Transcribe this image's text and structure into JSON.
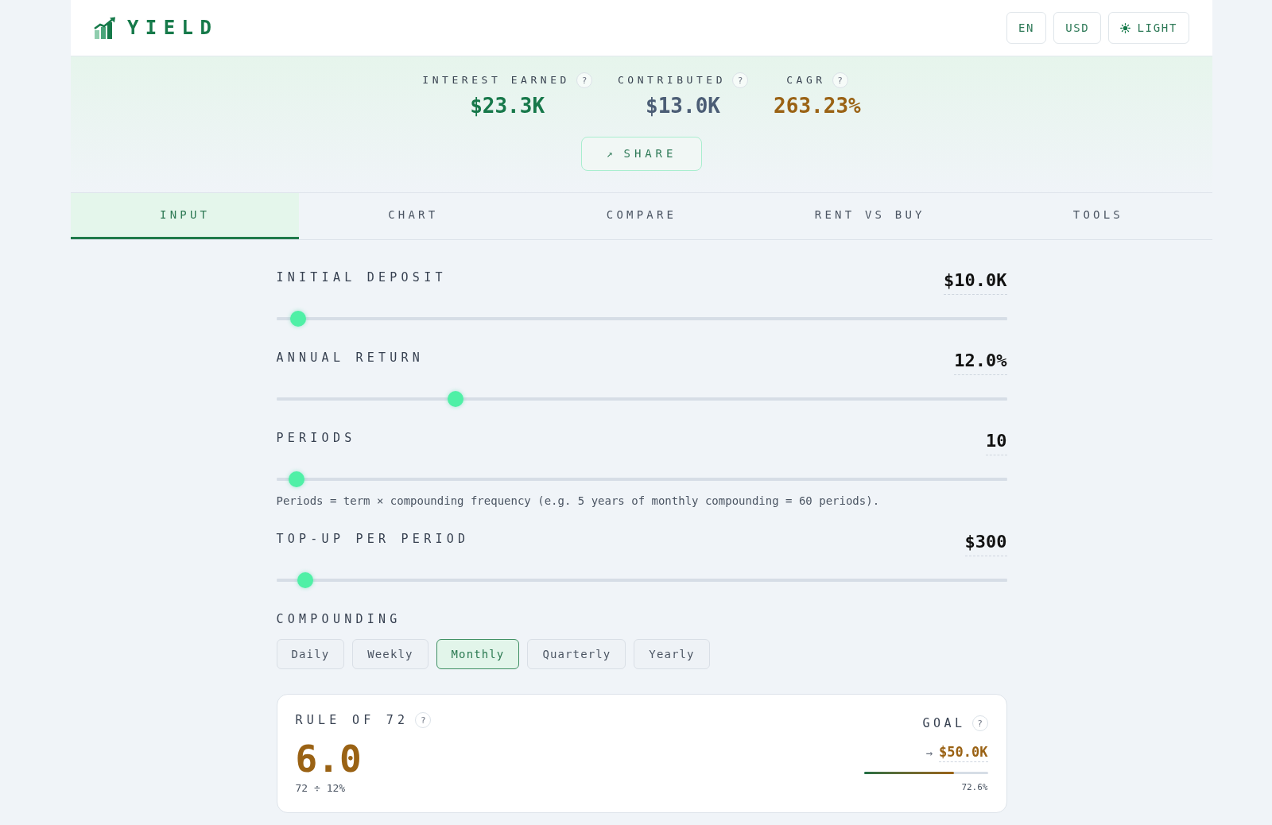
{
  "header": {
    "logo": "YIELD",
    "controls": [
      {
        "kind": "plain",
        "label": "EN"
      },
      {
        "kind": "plain",
        "label": "USD"
      },
      {
        "kind": "theme",
        "label": "LIGHT"
      }
    ]
  },
  "stats": [
    {
      "label": "INTEREST EARNED",
      "help": "?",
      "value": "$23.3K",
      "color": "#17784a"
    },
    {
      "label": "CONTRIBUTED",
      "help": "?",
      "value": "$13.0K",
      "color": "#4b5d75"
    },
    {
      "label": "CAGR",
      "help": "?",
      "value": "263.23%",
      "color": "#9a6214"
    }
  ],
  "share_button": {
    "icon": "↗",
    "label": "SHARE"
  },
  "tabs": [
    {
      "label": "INPUT",
      "selected": true
    },
    {
      "label": "CHART",
      "selected": false
    },
    {
      "label": "COMPARE",
      "selected": false
    },
    {
      "label": "RENT VS BUY",
      "selected": false
    },
    {
      "label": "TOOLS",
      "selected": false
    }
  ],
  "sliders": [
    {
      "label": "INITIAL DEPOSIT",
      "value": "$10.0K",
      "level": 0.02
    },
    {
      "label": "ANNUAL RETURN",
      "value": "12.0%",
      "level": 0.24
    },
    {
      "label": "PERIODS",
      "value": "10",
      "level": 0.017,
      "note": "Periods = term × compounding frequency (e.g. 5 years of monthly compounding = 60 periods)."
    },
    {
      "label": "TOP-UP PER PERIOD",
      "value": "$300",
      "level": 0.03
    }
  ],
  "compounding": {
    "label": "COMPOUNDING",
    "options": [
      {
        "label": "Daily",
        "selected": false
      },
      {
        "label": "Weekly",
        "selected": false
      },
      {
        "label": "Monthly",
        "selected": true
      },
      {
        "label": "Quarterly",
        "selected": false
      },
      {
        "label": "Yearly",
        "selected": false
      }
    ]
  },
  "rule_of_72": {
    "label": "RULE OF 72",
    "help": "?",
    "value": "6.0",
    "formula": "72 ÷ 12%"
  },
  "goal": {
    "label": "GOAL",
    "help": "?",
    "arrow": "→",
    "value": "$50.0K",
    "level": 0.726,
    "reading": "72.6%"
  }
}
